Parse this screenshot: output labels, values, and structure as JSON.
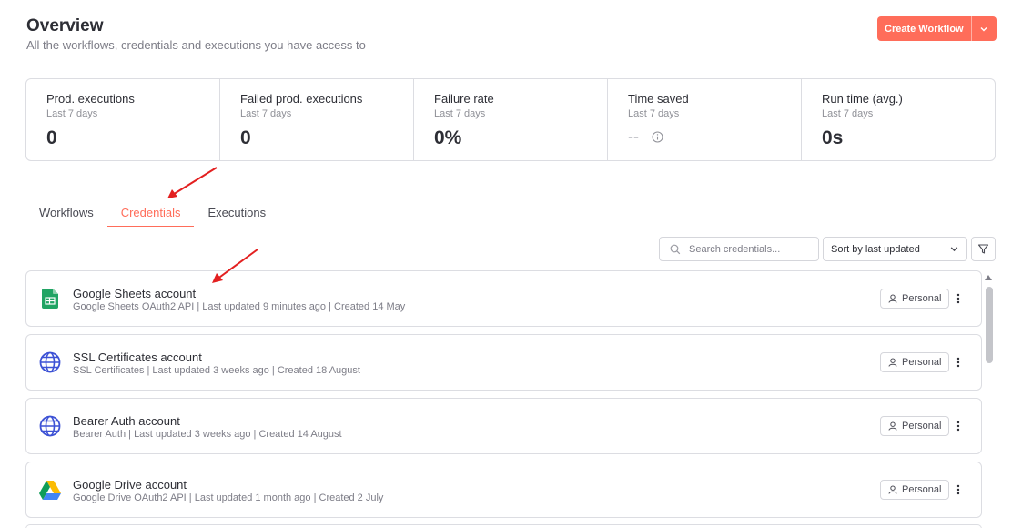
{
  "header": {
    "title": "Overview",
    "subtitle": "All the workflows, credentials and executions you have access to",
    "create_button": "Create Workflow"
  },
  "stats": [
    {
      "label": "Prod. executions",
      "period": "Last 7 days",
      "value": "0"
    },
    {
      "label": "Failed prod. executions",
      "period": "Last 7 days",
      "value": "0"
    },
    {
      "label": "Failure rate",
      "period": "Last 7 days",
      "value": "0%"
    },
    {
      "label": "Time saved",
      "period": "Last 7 days",
      "value": "--"
    },
    {
      "label": "Run time (avg.)",
      "period": "Last 7 days",
      "value": "0s"
    }
  ],
  "tabs": [
    {
      "label": "Workflows",
      "active": false
    },
    {
      "label": "Credentials",
      "active": true
    },
    {
      "label": "Executions",
      "active": false
    }
  ],
  "toolbar": {
    "search_placeholder": "Search credentials...",
    "sort_value": "Sort by last updated"
  },
  "credentials": [
    {
      "name": "Google Sheets account",
      "meta": "Google Sheets OAuth2 API | Last updated 9 minutes ago | Created 14 May",
      "icon": "google-sheets-icon",
      "badge": "Personal"
    },
    {
      "name": "SSL Certificates account",
      "meta": "SSL Certificates | Last updated 3 weeks ago | Created 18 August",
      "icon": "globe-icon",
      "badge": "Personal"
    },
    {
      "name": "Bearer Auth account",
      "meta": "Bearer Auth | Last updated 3 weeks ago | Created 14 August",
      "icon": "globe-icon",
      "badge": "Personal"
    },
    {
      "name": "Google Drive account",
      "meta": "Google Drive OAuth2 API | Last updated 1 month ago | Created 2 July",
      "icon": "google-drive-icon",
      "badge": "Personal"
    }
  ],
  "colors": {
    "accent": "#ff6d5a",
    "arrow": "#e32020",
    "sheets_green": "#21a464",
    "globe_blue": "#3d52d5"
  }
}
